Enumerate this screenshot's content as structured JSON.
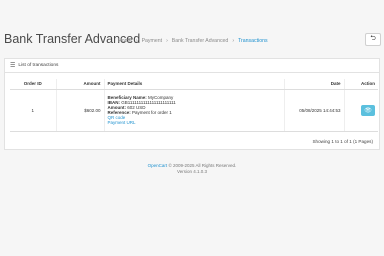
{
  "header": {
    "title": "Bank Transfer Advanced",
    "breadcrumb": [
      "Home",
      "Payment",
      "Bank Transfer Advanced",
      "Transactions"
    ],
    "separator": "›",
    "back_icon": "back-arrow-icon"
  },
  "panel": {
    "title": "List of transactions",
    "icon": "list-icon"
  },
  "table": {
    "columns": [
      "Order ID",
      "Amount",
      "Payment Details",
      "Date",
      "Action"
    ],
    "rows": [
      {
        "order_id": "1",
        "amount": "$602.00",
        "beneficiary_label": "Beneficiary Name:",
        "beneficiary_value": "MyCompany",
        "iban_label": "IBAN:",
        "iban_value": "GB1111111111111111111111",
        "amount_label": "Amount:",
        "amount_value": "602 USD",
        "reference_label": "Reference:",
        "reference_value": "Payment for order 1",
        "qr_link": "QR code",
        "url_link": "Payment URL",
        "date": "05/08/2025 14:44:53"
      }
    ]
  },
  "pagination": {
    "summary": "Showing 1 to 1 of 1 (1 Pages)"
  },
  "footer": {
    "brand": "OpenCart",
    "copyright": "© 2009-2025 All Rights Reserved.",
    "version": "Version 4.1.0.3"
  }
}
